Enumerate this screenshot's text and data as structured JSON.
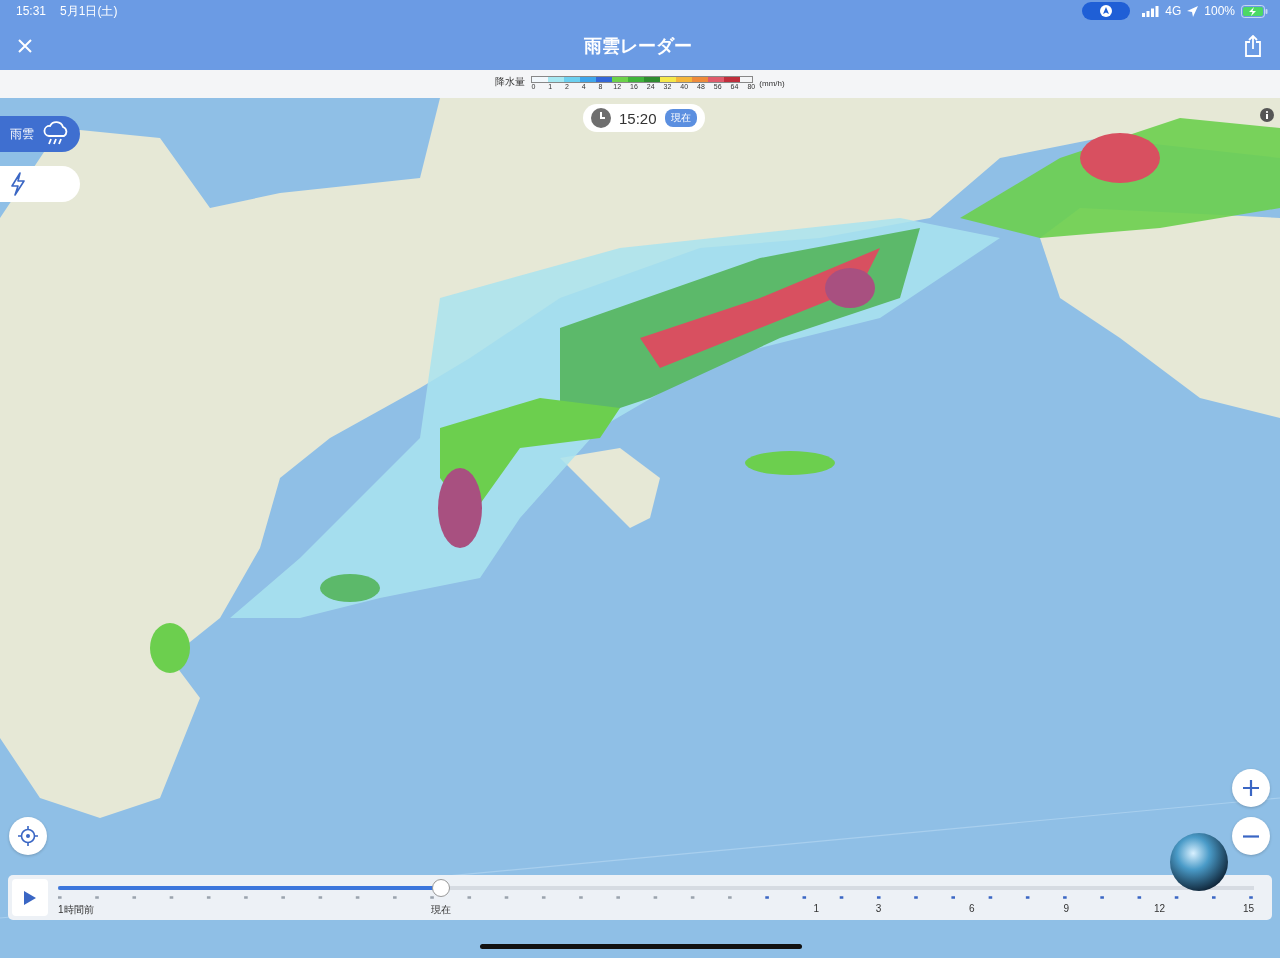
{
  "status_bar": {
    "time": "15:31",
    "date": "5月1日(土)",
    "network": "4G",
    "battery": "100%"
  },
  "header": {
    "title": "雨雲レーダー"
  },
  "legend": {
    "label": "降水量",
    "unit": "(mm/h)",
    "swatches": [
      {
        "color": "#f2f8fc"
      },
      {
        "color": "#a6e8f2"
      },
      {
        "color": "#6cd0f0"
      },
      {
        "color": "#3ea6ec"
      },
      {
        "color": "#3366d8"
      },
      {
        "color": "#6cd24a"
      },
      {
        "color": "#3fb43a"
      },
      {
        "color": "#2e8c2e"
      },
      {
        "color": "#f6e84a"
      },
      {
        "color": "#f5b63a"
      },
      {
        "color": "#ef8a3a"
      },
      {
        "color": "#e05a6a"
      },
      {
        "color": "#c02e3c"
      }
    ],
    "ticks": [
      "0",
      "1",
      "2",
      "4",
      "8",
      "12",
      "16",
      "24",
      "32",
      "40",
      "48",
      "56",
      "64",
      "80"
    ]
  },
  "time_badge": {
    "time": "15:20",
    "tag": "現在"
  },
  "layers": [
    {
      "kind": "rain",
      "label": "雨雲",
      "selected": true
    },
    {
      "kind": "lightning",
      "selected": false
    }
  ],
  "timeline": {
    "level": 0.32,
    "ticks": [
      "1時間前",
      "現在",
      "1",
      "3",
      "6",
      "9",
      "12",
      "15"
    ]
  }
}
